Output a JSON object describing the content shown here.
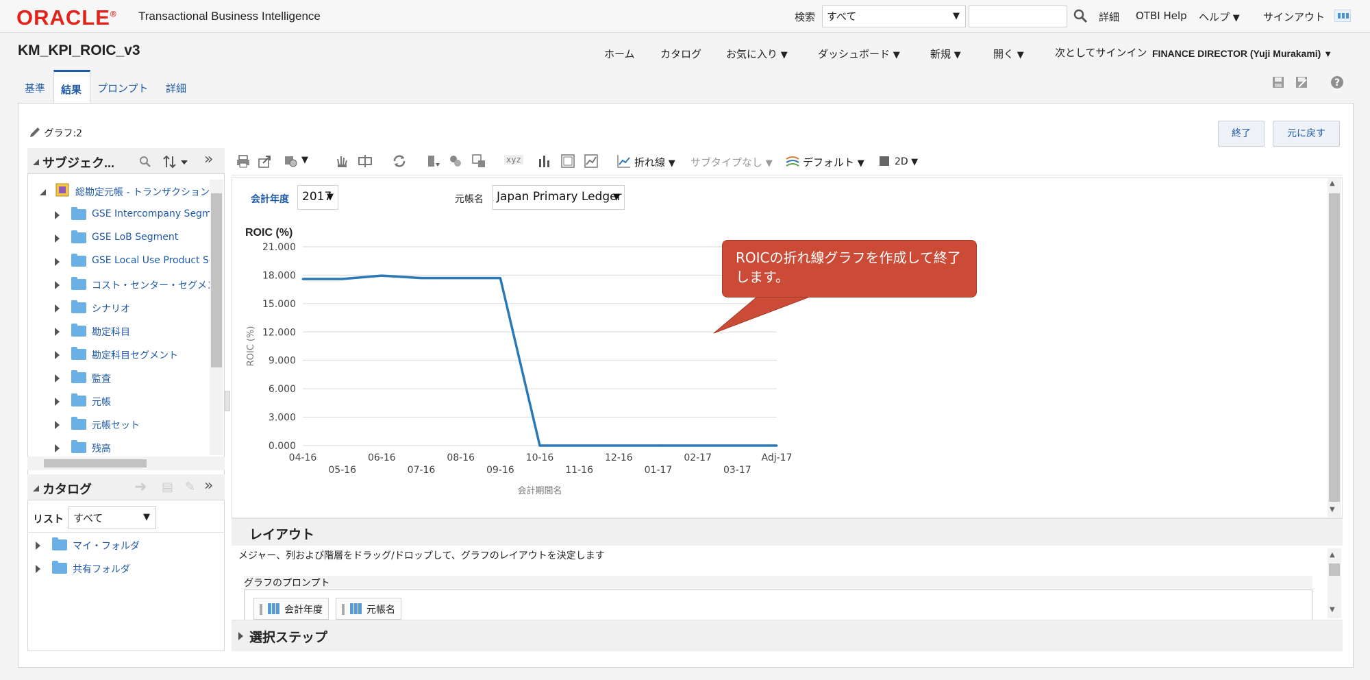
{
  "header": {
    "brand": "ORACLE",
    "brand_reg": "®",
    "product": "Transactional Business Intelligence",
    "search_label": "検索",
    "search_scope": "すべて",
    "search_value": "",
    "links": [
      "詳細",
      "OTBI Help",
      "ヘルプ",
      "サインアウト"
    ]
  },
  "title_bar": {
    "page_title": "KM_KPI_ROIC_v3",
    "nav": [
      "ホーム",
      "カタログ",
      "お気に入り",
      "ダッシュボード",
      "新規",
      "開く"
    ],
    "signin_label": "次としてサインイン",
    "user": "FINANCE DIRECTOR (Yuji Murakami)"
  },
  "tabs": [
    "基準",
    "結果",
    "プロンプト",
    "詳細"
  ],
  "editor": {
    "graph_label": "グラフ:2",
    "done_button": "終了",
    "revert_button": "元に戻す"
  },
  "subject_panel": {
    "title": "サブジェク...",
    "root": "総勘定元帳 - トランザクション",
    "items": [
      "GSE Intercompany Segment",
      "GSE LoB Segment",
      "GSE Local Use Product Segment",
      "コスト・センター・セグメント",
      "シナリオ",
      "勘定科目",
      "勘定科目セグメント",
      "監査",
      "元帳",
      "元帳セット",
      "残高"
    ]
  },
  "catalog_panel": {
    "title": "カタログ",
    "list_label": "リスト",
    "list_value": "すべて",
    "folders": [
      "マイ・フォルダ",
      "共有フォルダ"
    ]
  },
  "chart_toolbar": {
    "graph_type": "折れ線",
    "subtype": "サブタイプなし",
    "style": "デフォルト",
    "dimension": "2D",
    "xyz_label": "xyz"
  },
  "prompts": {
    "year_label": "会計年度",
    "year_value": "2017",
    "ledger_label": "元帳名",
    "ledger_value": "Japan Primary Ledger"
  },
  "callout": "ROICの折れ線グラフを作成して終了します。",
  "layout_section": {
    "title": "レイアウト",
    "description": "メジャー、列および階層をドラッグ/ドロップして、グラフのレイアウトを決定します",
    "graph_prompts_title": "グラフのプロンプト",
    "chips": [
      "会計年度",
      "元帳名"
    ]
  },
  "selection_steps": {
    "title": "選択ステップ"
  },
  "colors": {
    "oracle_red": "#e2231a",
    "link_blue": "#1f5aa6",
    "series_line": "#2b78b5",
    "callout_fill": "#cc4b37"
  },
  "chart_data": {
    "type": "line",
    "title": "ROIC (%)",
    "xlabel": "会計期間名",
    "ylabel": "ROIC (%)",
    "categories": [
      "04-16",
      "05-16",
      "06-16",
      "07-16",
      "08-16",
      "09-16",
      "10-16",
      "11-16",
      "12-16",
      "01-17",
      "02-17",
      "03-17",
      "Adj-17"
    ],
    "yticks": [
      "0.000",
      "3.000",
      "6.000",
      "9.000",
      "12.000",
      "15.000",
      "18.000",
      "21.000"
    ],
    "ylim": [
      0,
      21
    ],
    "series": [
      {
        "values": [
          17.6,
          17.6,
          17.95,
          17.7,
          17.7,
          17.7,
          0,
          0,
          0,
          0,
          0,
          0,
          0
        ]
      }
    ],
    "grid": true,
    "legend": "none"
  }
}
